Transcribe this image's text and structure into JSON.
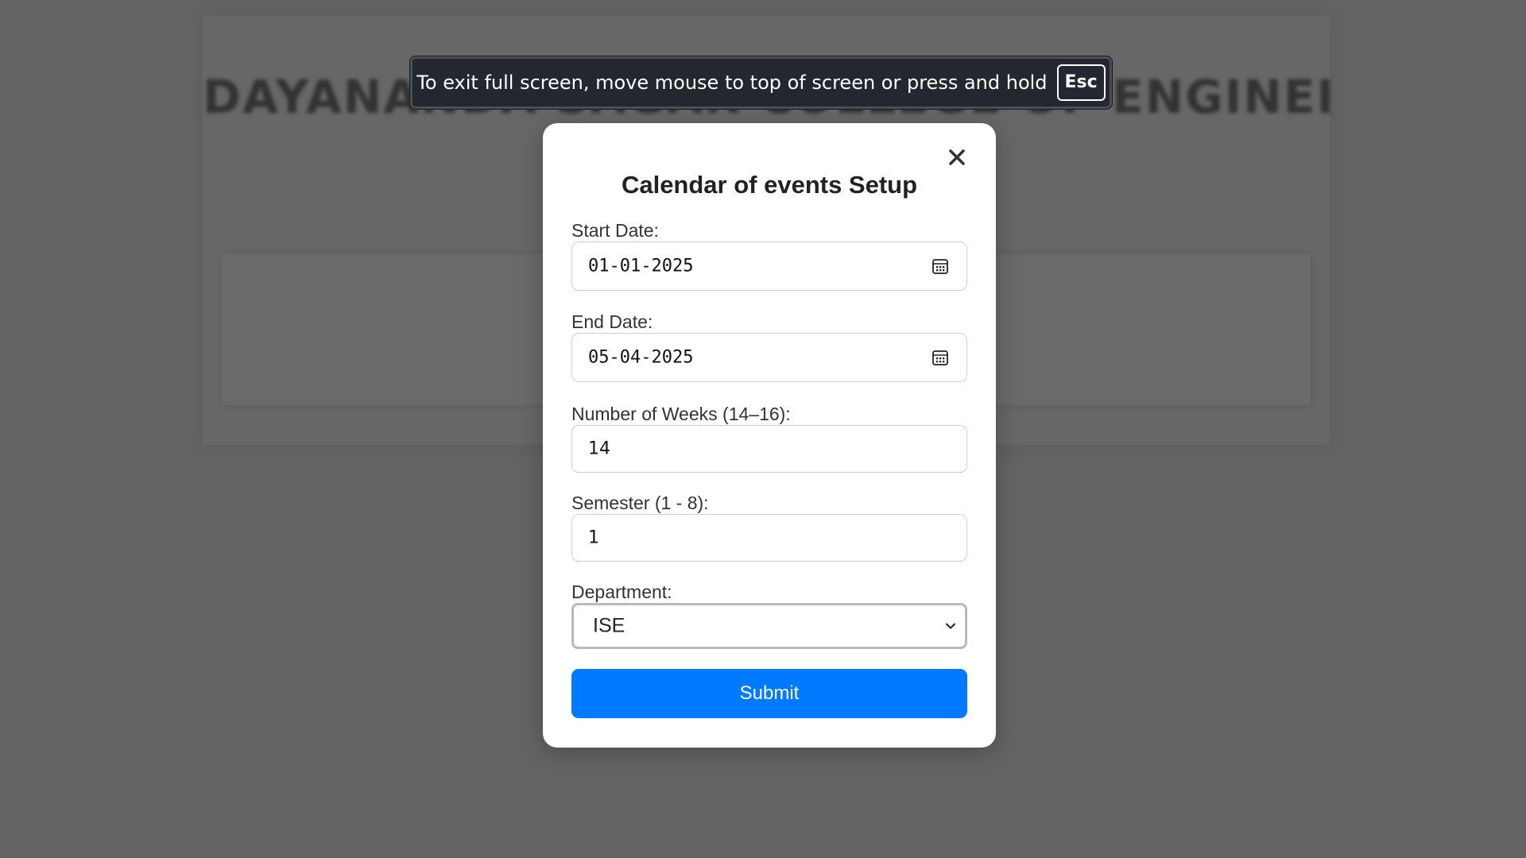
{
  "background": {
    "page_heading": "DAYANANDA SAGAR COLLEGE OF ENGINEERING"
  },
  "fullscreen_notice": {
    "message": "To exit full screen, move mouse to top of screen or press and hold",
    "key": "Esc"
  },
  "modal": {
    "title": "Calendar of events Setup",
    "close_icon": "close-icon",
    "start_date": {
      "label": "Start Date:",
      "value": "01-01-2025",
      "icon": "calendar-icon"
    },
    "end_date": {
      "label": "End Date:",
      "value": "05-04-2025",
      "icon": "calendar-icon"
    },
    "weeks": {
      "label": "Number of Weeks (14–16):",
      "value": "14"
    },
    "semester": {
      "label": "Semester (1 - 8):",
      "value": "1"
    },
    "department": {
      "label": "Department:",
      "value": "ISE",
      "icon": "chevron-down-icon"
    },
    "submit_label": "Submit"
  },
  "colors": {
    "overlay": "#646464",
    "notice_bg": "#23272f",
    "submit_bg": "#007bff",
    "modal_bg": "#ffffff"
  }
}
